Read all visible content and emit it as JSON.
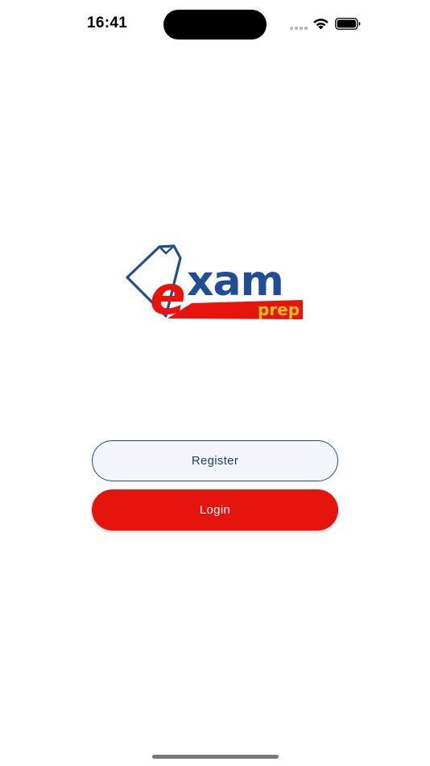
{
  "status_bar": {
    "time": "16:41",
    "icons": [
      "cellular-signal-icon",
      "wifi-icon",
      "battery-icon"
    ]
  },
  "logo": {
    "text_main": "exam",
    "text_sub": "prep",
    "colors": {
      "blue": "#1f4e96",
      "red": "#e5140c",
      "yellow": "#f5c10f"
    }
  },
  "buttons": {
    "register_label": "Register",
    "login_label": "Login"
  },
  "colors": {
    "accent_red": "#e5140c",
    "accent_blue": "#1d4f8c",
    "background": "#ffffff"
  }
}
